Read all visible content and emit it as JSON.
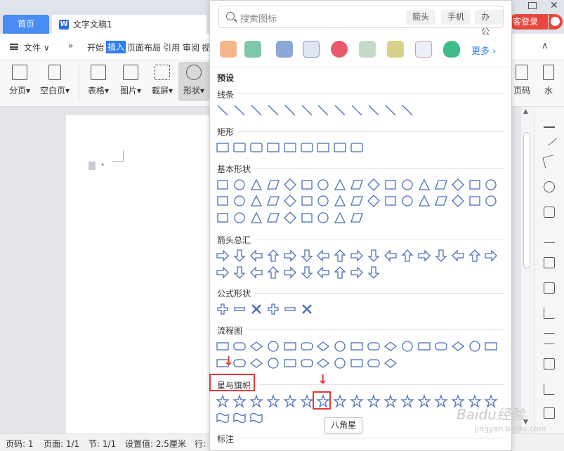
{
  "titlebar": {
    "home_tab": "首页",
    "doc_tab": "文字文稿1",
    "login": "客登录"
  },
  "menu": {
    "file": "文件",
    "items": [
      "开始",
      "插入",
      "页面布局",
      "引用",
      "审阅",
      "视"
    ],
    "active": "插入"
  },
  "ribbon": {
    "buttons": [
      "分页",
      "空白页",
      "表格",
      "图片",
      "截屏",
      "形状"
    ],
    "right_buttons": [
      "页码",
      "水"
    ]
  },
  "panel": {
    "search_placeholder": "搜索图标",
    "chips": [
      "箭头",
      "手机",
      "办公"
    ],
    "more_label": "更多",
    "preset_label": "预设",
    "categories": [
      "线条",
      "矩形",
      "基本形状",
      "箭头总汇",
      "公式形状",
      "流程图",
      "星与旗帜",
      "标注"
    ],
    "tooltip": "八角星"
  },
  "statusbar": {
    "page": "页码: 1",
    "pages": "页面: 1/1",
    "section": "节: 1/1",
    "setting": "设置值: 2.5厘米",
    "row": "行:"
  },
  "watermark": {
    "main": "Baidu经验",
    "sub": "jingyan.baidu.com"
  },
  "colors": {
    "accent": "#2f7cf6",
    "highlight": "#e53935",
    "shape_stroke": "#4a6fb8"
  }
}
